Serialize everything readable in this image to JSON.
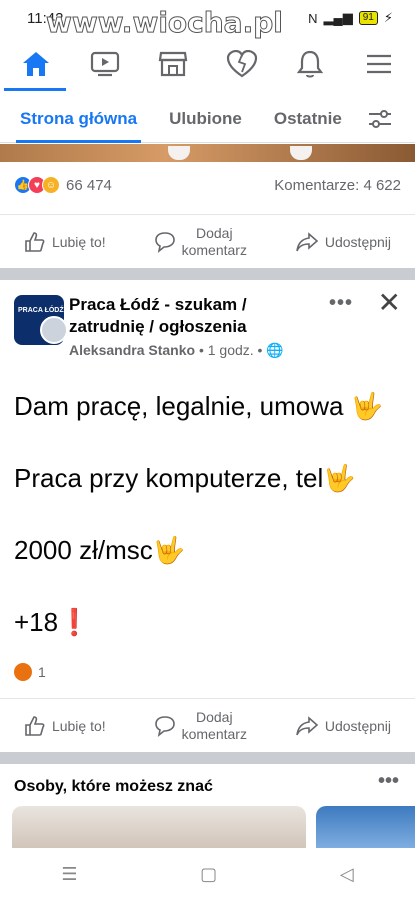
{
  "status": {
    "time": "11:42",
    "watermark": "www.wiocha.pl",
    "battery": "91"
  },
  "tabs": {
    "home": "Strona główna",
    "favorites": "Ulubione",
    "recent": "Ostatnie"
  },
  "top_post": {
    "reaction_count": "66 474",
    "comments": "Komentarze: 4 622"
  },
  "actions": {
    "like": "Lubię to!",
    "comment_line1": "Dodaj",
    "comment_line2": "komentarz",
    "share": "Udostępnij"
  },
  "post": {
    "group_line1": "Praca Łódź - szukam /",
    "group_line2": "zatrudnię / ogłoszenia",
    "author": "Aleksandra Stanko",
    "time": " • 1 godz. • ",
    "avatar_text": "PRACA ŁÓDŹ",
    "lines": [
      "Dam pracę, legalnie, umowa ",
      "Praca przy komputerze, tel",
      "2000 zł/msc",
      "+18"
    ],
    "reaction_count": "1"
  },
  "pymk": {
    "title": "Osoby, które możesz znać"
  },
  "icons": {
    "home": "home-icon",
    "watch": "video-icon",
    "marketplace": "shop-icon",
    "dating": "heart-icon",
    "notifications": "bell-icon",
    "menu": "menu-icon"
  },
  "colors": {
    "accent": "#1877f2",
    "gray_text": "#65676b",
    "divider": "#c9ccd1"
  }
}
